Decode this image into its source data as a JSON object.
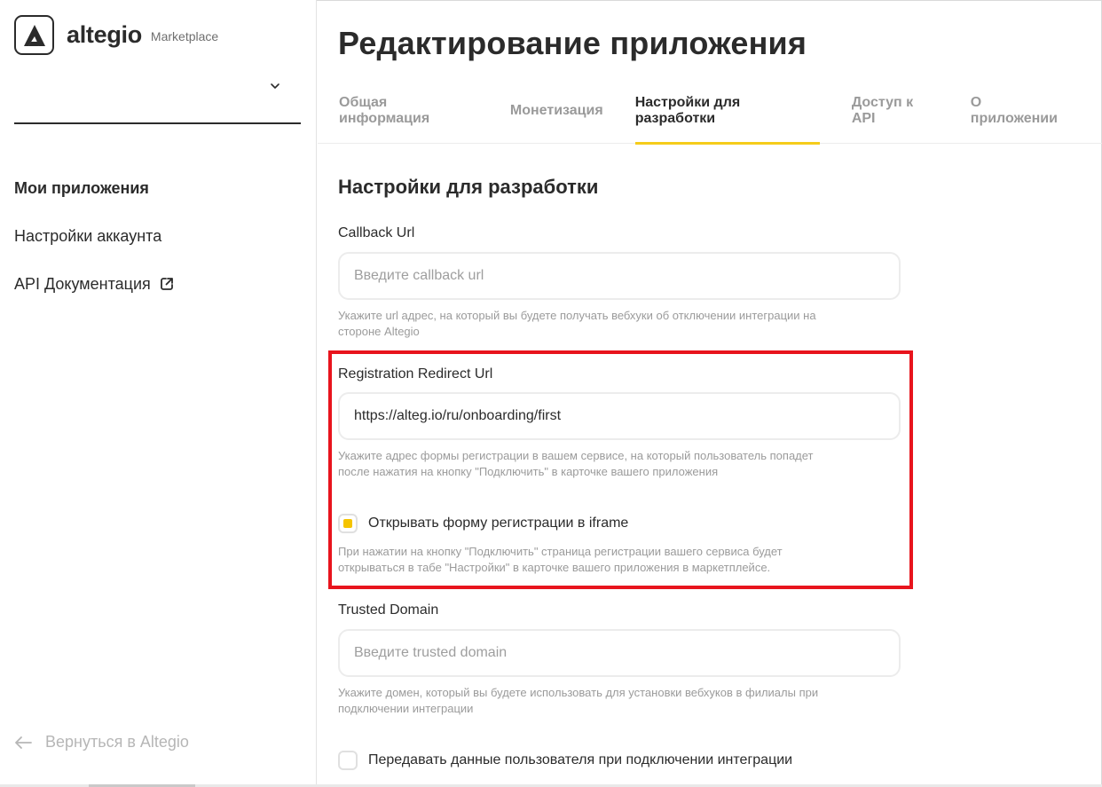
{
  "brand": {
    "name": "altegio",
    "subtitle": "Marketplace"
  },
  "sidebar": {
    "account_select": {
      "value": ""
    },
    "items": [
      {
        "label": "Мои приложения",
        "active": true
      },
      {
        "label": "Настройки аккаунта",
        "active": false
      },
      {
        "label": "API Документация",
        "active": false,
        "icon": "external-link-icon"
      }
    ],
    "back_label": "Вернуться в Altegio"
  },
  "main": {
    "title": "Редактирование приложения",
    "tabs": [
      {
        "label": "Общая информация",
        "active": false
      },
      {
        "label": "Монетизация",
        "active": false
      },
      {
        "label": "Настройки для разработки",
        "active": true
      },
      {
        "label": "Доступ к API",
        "active": false
      },
      {
        "label": "О приложении",
        "active": false
      }
    ],
    "section_title": "Настройки для разработки",
    "callback": {
      "label": "Callback Url",
      "placeholder": "Введите callback url",
      "value": "",
      "hint_line1": "Укажите url адрес, на который вы будете получать вебхуки об отключении интеграции на",
      "hint_line2": "стороне Altegio"
    },
    "redirect": {
      "label": "Registration Redirect Url",
      "placeholder": "",
      "value": "https://alteg.io/ru/onboarding/first",
      "hint_line1": "Укажите адрес формы регистрации в вашем сервисе, на который пользователь попадет",
      "hint_line2": "после нажатия на кнопку \"Подключить\" в карточке вашего приложения"
    },
    "iframe": {
      "label": "Открывать форму регистрации в iframe",
      "checked": true,
      "hint_line1": "При нажатии на кнопку \"Подключить\" страница регистрации вашего сервиса будет",
      "hint_line2": "открываться в табе \"Настройки\" в карточке вашего приложения в маркетплейсе."
    },
    "trusted": {
      "label": "Trusted Domain",
      "placeholder": "Введите trusted domain",
      "value": "",
      "hint_line1": "Укажите домен, который вы будете использовать для установки вебхуков в филиалы при",
      "hint_line2": "подключении интеграции"
    },
    "pass_user": {
      "label": "Передавать данные пользователя при подключении интеграции",
      "checked": false
    }
  },
  "colors": {
    "accent": "#f5cc1b",
    "highlight": "#e8141d",
    "text": "#2b2b2b",
    "muted": "#9b9b9b"
  }
}
